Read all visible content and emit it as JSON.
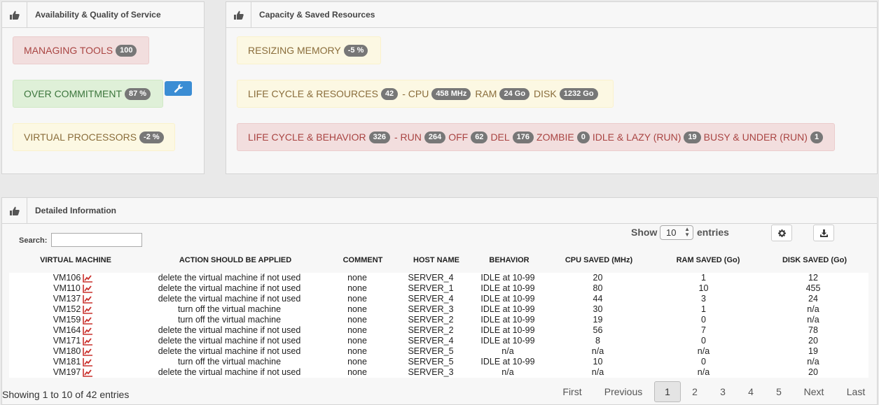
{
  "panels": {
    "availability": {
      "title": "Availability & Quality of Service"
    },
    "capacity": {
      "title": "Capacity & Saved Resources"
    },
    "detailed": {
      "title": "Detailed Information"
    }
  },
  "availability_boxes": {
    "managing_tools": {
      "label": "MANAGING TOOLS",
      "badge": "100"
    },
    "over_commitment": {
      "label": "OVER COMMITMENT",
      "badge": "87 %"
    },
    "virtual_processors": {
      "label": "VIRTUAL PROCESSORS",
      "badge": "-2 %"
    }
  },
  "capacity_boxes": {
    "resizing_memory": {
      "label": "RESIZING MEMORY",
      "badge": "-5 %"
    },
    "life_cycle_resources": {
      "label": "LIFE CYCLE & RESOURCES",
      "badge": "42",
      "cpu_label": "- CPU",
      "cpu_badge": "458 MHz",
      "ram_label": "RAM",
      "ram_badge": "24 Go",
      "disk_label": "DISK",
      "disk_badge": "1232 Go"
    },
    "life_cycle_behavior": {
      "label": "LIFE CYCLE & BEHAVIOR",
      "badge": "326",
      "run_label": "- RUN",
      "run_badge": "264",
      "off_label": "OFF",
      "off_badge": "62",
      "del_label": "DEL",
      "del_badge": "176",
      "zombie_label": "ZOMBIE",
      "zombie_badge": "0",
      "idle_label": "IDLE & LAZY (RUN)",
      "idle_badge": "19",
      "busy_label": "BUSY & UNDER (RUN)",
      "busy_badge": "1"
    }
  },
  "controls": {
    "search_label": "Search:",
    "search_value": "",
    "show_label": "Show",
    "show_value": "10",
    "entries_label": "entries"
  },
  "columns": [
    "VIRTUAL MACHINE",
    "ACTION SHOULD BE APPLIED",
    "COMMENT",
    "HOST NAME",
    "BEHAVIOR",
    "CPU SAVED (MHz)",
    "RAM SAVED (Go)",
    "DISK SAVED (Go)"
  ],
  "rows": [
    [
      "VM106",
      "delete the virtual machine if not used",
      "none",
      "SERVER_4",
      "IDLE at 10-99",
      "20",
      "1",
      "12"
    ],
    [
      "VM110",
      "delete the virtual machine if not used",
      "none",
      "SERVER_1",
      "IDLE at 10-99",
      "80",
      "10",
      "455"
    ],
    [
      "VM137",
      "delete the virtual machine if not used",
      "none",
      "SERVER_4",
      "IDLE at 10-99",
      "44",
      "3",
      "24"
    ],
    [
      "VM152",
      "turn off the virtual machine",
      "none",
      "SERVER_3",
      "IDLE at 10-99",
      "30",
      "1",
      "n/a"
    ],
    [
      "VM159",
      "turn off the virtual machine",
      "none",
      "SERVER_2",
      "IDLE at 10-99",
      "19",
      "0",
      "n/a"
    ],
    [
      "VM164",
      "delete the virtual machine if not used",
      "none",
      "SERVER_2",
      "IDLE at 10-99",
      "56",
      "7",
      "78"
    ],
    [
      "VM171",
      "delete the virtual machine if not used",
      "none",
      "SERVER_4",
      "IDLE at 10-99",
      "8",
      "0",
      "20"
    ],
    [
      "VM180",
      "delete the virtual machine if not used",
      "none",
      "SERVER_5",
      "n/a",
      "n/a",
      "n/a",
      "19"
    ],
    [
      "VM181",
      "turn off the virtual machine",
      "none",
      "SERVER_5",
      "IDLE at 10-99",
      "10",
      "0",
      "n/a"
    ],
    [
      "VM197",
      "delete the virtual machine if not used",
      "none",
      "SERVER_3",
      "n/a",
      "n/a",
      "n/a",
      "20"
    ]
  ],
  "footer": {
    "info": "Showing 1 to 10 of 42 entries",
    "first": "First",
    "previous": "Previous",
    "pages": [
      "1",
      "2",
      "3",
      "4",
      "5"
    ],
    "next": "Next",
    "last": "Last"
  },
  "icons": {
    "panel": "thumbs-up-icon",
    "settings": "gear-icon",
    "download": "download-icon",
    "configure": "wrench-icon",
    "trend": "line-chart-icon"
  },
  "colors": {
    "red_alert": "#f2dede",
    "green_alert": "#dff0d8",
    "yellow_alert": "#fcf8e3",
    "badge": "#777777",
    "wrench_button": "#3b8dd4",
    "trend_icon": "#c9302c"
  }
}
